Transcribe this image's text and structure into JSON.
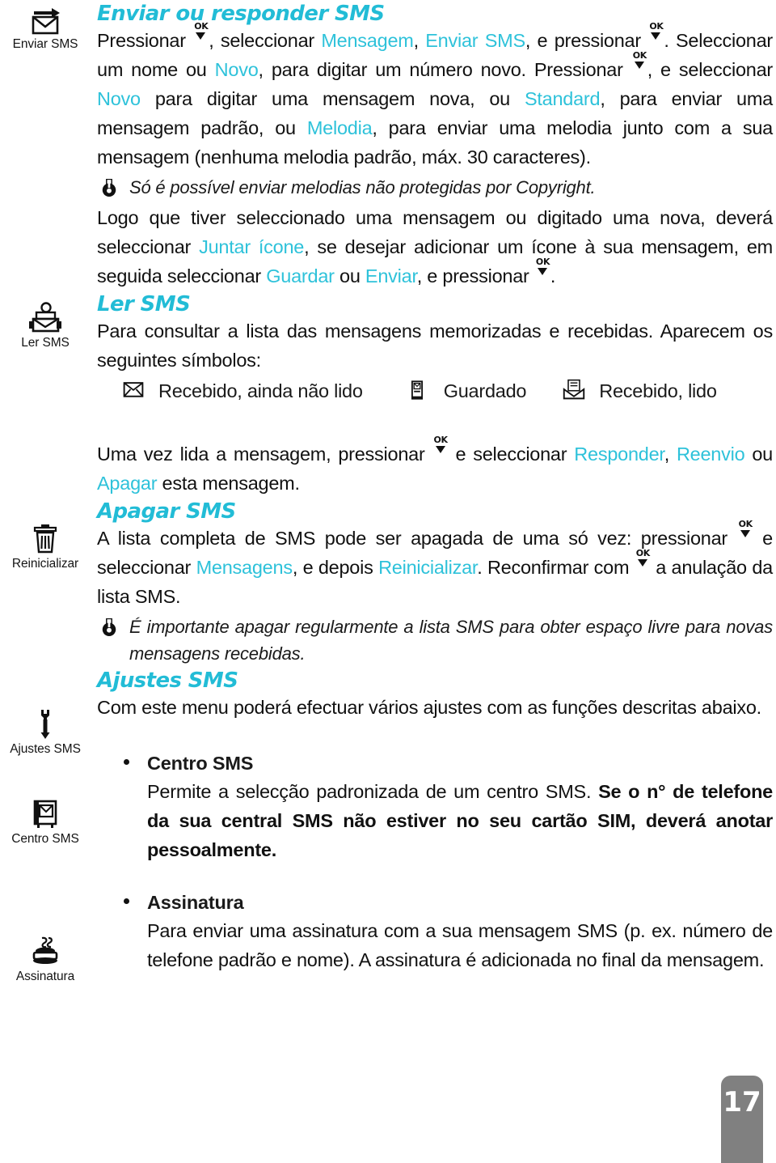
{
  "page": {
    "number": "17",
    "accent_color": "#2ec2da",
    "text_color": "#111111",
    "page_tab_color": "#808080"
  },
  "sidebar": {
    "items": [
      {
        "icon": "envelope-arrow-icon",
        "label": "Enviar SMS"
      },
      {
        "icon": "read-message-icon",
        "label": "Ler SMS"
      },
      {
        "icon": "trash-can-icon",
        "label": "Reinicializar"
      },
      {
        "icon": "wrench-icon",
        "label": "Ajustes SMS"
      },
      {
        "icon": "sms-center-icon",
        "label": "Centro SMS"
      },
      {
        "icon": "stamp-icon",
        "label": "Assinatura"
      }
    ]
  },
  "content": {
    "section_enviar": {
      "heading": "Enviar ou responder SMS",
      "p1_a": "Pressionar ",
      "p1_b": ", seleccionar ",
      "p1_link1": "Mensagem",
      "p1_c": ", ",
      "p1_link2": "Enviar SMS",
      "p1_d": ", e pressionar ",
      "p1_e": ". Seleccionar um nome ou ",
      "p1_link3": "Novo",
      "p1_f": ", para digitar um número novo. Pressionar ",
      "p1_g": ", e seleccionar ",
      "p1_link4": "Novo",
      "p1_h": " para digitar uma mensagem nova, ou ",
      "p1_link5": "Standard",
      "p1_i": ", para enviar uma mensagem padrão, ou ",
      "p1_link6": "Melodia",
      "p1_j": ", para enviar uma melodia junto com a sua mensagem (nenhuma melodia padrão, máx. 30 caracteres)."
    },
    "note_copyright": {
      "icon": "note-key-icon",
      "text": "Só é possível enviar melodias não protegidas por Copyright."
    },
    "section_logo": {
      "a": "Logo que tiver seleccionado uma mensagem ou digitado uma nova, deverá seleccionar ",
      "link1": "Juntar ícone",
      "b": ", se desejar adicionar um ícone à sua mensagem, em seguida seleccionar ",
      "link2": "Guardar",
      "c": " ou ",
      "link3": "Enviar",
      "d": ", e pressionar ",
      "e": "."
    },
    "section_ler": {
      "heading": "Ler SMS",
      "p1": "Para consultar a lista das mensagens memorizadas e recebidas.  Aparecem os seguintes símbolos:",
      "symbols": [
        {
          "icon": "closed-envelope-icon",
          "label": "Recebido, ainda não lido"
        },
        {
          "icon": "saved-message-icon",
          "label": "Guardado"
        },
        {
          "icon": "opened-envelope-icon",
          "label": "Recebido, lido"
        }
      ],
      "p2_a": "Uma vez lida a mensagem, pressionar ",
      "p2_b": " e seleccionar  ",
      "p2_link1": "Responder",
      "p2_c": ", ",
      "p2_link2": "Reenvio",
      "p2_d": " ou ",
      "p2_link3": "Apagar",
      "p2_e": " esta mensagem."
    },
    "section_apagar": {
      "heading": "Apagar SMS",
      "a": "A lista completa de SMS pode ser apagada de uma só vez: pressionar ",
      "b": " e seleccionar ",
      "link1": "Mensagens",
      "c": ", e depois ",
      "link2": "Reinicializar",
      "d": ". Reconfirmar com ",
      "e": " a anulação da lista SMS."
    },
    "note_apagar": {
      "icon": "note-key-icon",
      "text": "É importante apagar regularmente a lista SMS para obter espaço livre para novas mensagens recebidas."
    },
    "section_ajustes": {
      "heading": "Ajustes SMS",
      "p1": "Com este menu poderá efectuar vários ajustes com as funções descritas abaixo."
    },
    "bullet_centro": {
      "title": "Centro SMS",
      "a": "Permite a selecção padronizada de um centro SMS. ",
      "b": "Se o n° de telefone da sua central SMS não estiver  no seu cartão SIM, deverá anotar pessoalmente."
    },
    "bullet_assinatura": {
      "title": "Assinatura",
      "a": "Para enviar uma assinatura com a sua mensagem SMS (p. ex. número de telefone padrão e nome). A assinatura é adicionada no final da mensagem."
    }
  }
}
